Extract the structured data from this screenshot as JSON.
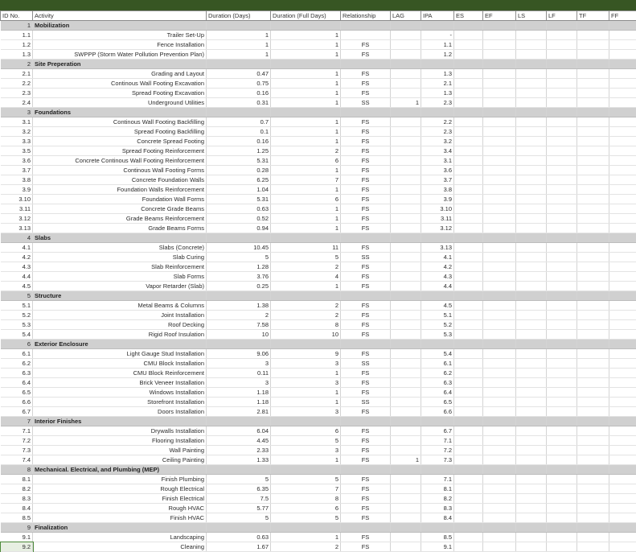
{
  "sheet": {
    "headers": [
      "ID No.",
      "Activity",
      "Duration (Days)",
      "Duration (Full Days)",
      "Relationship",
      "LAG",
      "IPA",
      "ES",
      "EF",
      "LS",
      "LF",
      "TF",
      "FF"
    ],
    "header_bar_color": "#375623",
    "section_fill_color": "#d0d0d0",
    "rows": [
      {
        "type": "section",
        "id": "1",
        "name": "Mobilization"
      },
      {
        "type": "task",
        "id": "1.1",
        "activity": "Trailer Set-Up",
        "dur": "1",
        "full": "1",
        "rel": "",
        "lag": "",
        "ipa": "-"
      },
      {
        "type": "task",
        "id": "1.2",
        "activity": "Fence Installation",
        "dur": "1",
        "full": "1",
        "rel": "FS",
        "lag": "",
        "ipa": "1.1"
      },
      {
        "type": "task",
        "id": "1.3",
        "activity": "SWPPP (Storm Water Pollution Prevention Plan)",
        "dur": "1",
        "full": "1",
        "rel": "FS",
        "lag": "",
        "ipa": "1.2"
      },
      {
        "type": "section",
        "id": "2",
        "name": "Site Preperation"
      },
      {
        "type": "task",
        "id": "2.1",
        "activity": "Grading and Layout",
        "dur": "0.47",
        "full": "1",
        "rel": "FS",
        "lag": "",
        "ipa": "1.3"
      },
      {
        "type": "task",
        "id": "2.2",
        "activity": "Continous Wall Footing Excavation",
        "dur": "0.75",
        "full": "1",
        "rel": "FS",
        "lag": "",
        "ipa": "2.1"
      },
      {
        "type": "task",
        "id": "2.3",
        "activity": "Spread Footing Excavation",
        "dur": "0.16",
        "full": "1",
        "rel": "FS",
        "lag": "",
        "ipa": "1.3"
      },
      {
        "type": "task",
        "id": "2.4",
        "activity": "Underground Utilities",
        "dur": "0.31",
        "full": "1",
        "rel": "SS",
        "lag": "1",
        "ipa": "2.3"
      },
      {
        "type": "section",
        "id": "3",
        "name": "Foundations"
      },
      {
        "type": "task",
        "id": "3.1",
        "activity": "Continous Wall Footing Backfilling",
        "dur": "0.7",
        "full": "1",
        "rel": "FS",
        "lag": "",
        "ipa": "2.2"
      },
      {
        "type": "task",
        "id": "3.2",
        "activity": "Spread Footing Backfilling",
        "dur": "0.1",
        "full": "1",
        "rel": "FS",
        "lag": "",
        "ipa": "2.3"
      },
      {
        "type": "task",
        "id": "3.3",
        "activity": "Concrete Spread Footing",
        "dur": "0.16",
        "full": "1",
        "rel": "FS",
        "lag": "",
        "ipa": "3.2"
      },
      {
        "type": "task",
        "id": "3.5",
        "activity": "Spread Footing Reinforcement",
        "dur": "1.25",
        "full": "2",
        "rel": "FS",
        "lag": "",
        "ipa": "3.4"
      },
      {
        "type": "task",
        "id": "3.6",
        "activity": "Concrete Continous Wall Footing Reinforcement",
        "dur": "5.31",
        "full": "6",
        "rel": "FS",
        "lag": "",
        "ipa": "3.1"
      },
      {
        "type": "task",
        "id": "3.7",
        "activity": "Continous Wall Footing Forms",
        "dur": "0.28",
        "full": "1",
        "rel": "FS",
        "lag": "",
        "ipa": "3.6"
      },
      {
        "type": "task",
        "id": "3.8",
        "activity": "Concrete Foundation Walls",
        "dur": "6.25",
        "full": "7",
        "rel": "FS",
        "lag": "",
        "ipa": "3.7"
      },
      {
        "type": "task",
        "id": "3.9",
        "activity": "Foundation Walls Reinforcement",
        "dur": "1.04",
        "full": "1",
        "rel": "FS",
        "lag": "",
        "ipa": "3.8"
      },
      {
        "type": "task",
        "id": "3.10",
        "activity": "Foundation Wall Forms",
        "dur": "5.31",
        "full": "6",
        "rel": "FS",
        "lag": "",
        "ipa": "3.9"
      },
      {
        "type": "task",
        "id": "3.11",
        "activity": "Concrete Grade Beams",
        "dur": "0.63",
        "full": "1",
        "rel": "FS",
        "lag": "",
        "ipa": "3.10"
      },
      {
        "type": "task",
        "id": "3.12",
        "activity": "Grade Beams Reinforcement",
        "dur": "0.52",
        "full": "1",
        "rel": "FS",
        "lag": "",
        "ipa": "3.11"
      },
      {
        "type": "task",
        "id": "3.13",
        "activity": "Grade Beams Forms",
        "dur": "0.94",
        "full": "1",
        "rel": "FS",
        "lag": "",
        "ipa": "3.12"
      },
      {
        "type": "section",
        "id": "4",
        "name": "Slabs"
      },
      {
        "type": "task",
        "id": "4.1",
        "activity": "Slabs (Concrete)",
        "dur": "10.45",
        "full": "11",
        "rel": "FS",
        "lag": "",
        "ipa": "3.13"
      },
      {
        "type": "task",
        "id": "4.2",
        "activity": "Slab Curing",
        "dur": "5",
        "full": "5",
        "rel": "SS",
        "lag": "",
        "ipa": "4.1"
      },
      {
        "type": "task",
        "id": "4.3",
        "activity": "Slab Reinforcement",
        "dur": "1.28",
        "full": "2",
        "rel": "FS",
        "lag": "",
        "ipa": "4.2"
      },
      {
        "type": "task",
        "id": "4.4",
        "activity": "Slab Forms",
        "dur": "3.76",
        "full": "4",
        "rel": "FS",
        "lag": "",
        "ipa": "4.3"
      },
      {
        "type": "task",
        "id": "4.5",
        "activity": "Vapor Retarder (Slab)",
        "dur": "0.25",
        "full": "1",
        "rel": "FS",
        "lag": "",
        "ipa": "4.4"
      },
      {
        "type": "section",
        "id": "5",
        "name": "Structure"
      },
      {
        "type": "task",
        "id": "5.1",
        "activity": "Metal Beams & Columns",
        "dur": "1.38",
        "full": "2",
        "rel": "FS",
        "lag": "",
        "ipa": "4.5"
      },
      {
        "type": "task",
        "id": "5.2",
        "activity": "Joint Installation",
        "dur": "2",
        "full": "2",
        "rel": "FS",
        "lag": "",
        "ipa": "5.1"
      },
      {
        "type": "task",
        "id": "5.3",
        "activity": "Roof Decking",
        "dur": "7.58",
        "full": "8",
        "rel": "FS",
        "lag": "",
        "ipa": "5.2"
      },
      {
        "type": "task",
        "id": "5.4",
        "activity": "Rigid Roof Insulation",
        "dur": "10",
        "full": "10",
        "rel": "FS",
        "lag": "",
        "ipa": "5.3"
      },
      {
        "type": "section",
        "id": "6",
        "name": "Exterior Enclosure"
      },
      {
        "type": "task",
        "id": "6.1",
        "activity": "Light Gauge Stud Installation",
        "dur": "9.06",
        "full": "9",
        "rel": "FS",
        "lag": "",
        "ipa": "5.4"
      },
      {
        "type": "task",
        "id": "6.2",
        "activity": "CMU Block Installation",
        "dur": "3",
        "full": "3",
        "rel": "SS",
        "lag": "",
        "ipa": "6.1"
      },
      {
        "type": "task",
        "id": "6.3",
        "activity": "CMU Block Reinforcement",
        "dur": "0.11",
        "full": "1",
        "rel": "FS",
        "lag": "",
        "ipa": "6.2"
      },
      {
        "type": "task",
        "id": "6.4",
        "activity": "Brick Veneer Installation",
        "dur": "3",
        "full": "3",
        "rel": "FS",
        "lag": "",
        "ipa": "6.3"
      },
      {
        "type": "task",
        "id": "6.5",
        "activity": "Windows Installation",
        "dur": "1.18",
        "full": "1",
        "rel": "FS",
        "lag": "",
        "ipa": "6.4"
      },
      {
        "type": "task",
        "id": "6.6",
        "activity": "Storefront Installation",
        "dur": "1.18",
        "full": "1",
        "rel": "SS",
        "lag": "",
        "ipa": "6.5"
      },
      {
        "type": "task",
        "id": "6.7",
        "activity": "Doors Installation",
        "dur": "2.81",
        "full": "3",
        "rel": "FS",
        "lag": "",
        "ipa": "6.6"
      },
      {
        "type": "section",
        "id": "7",
        "name": "Interior Finishes"
      },
      {
        "type": "task",
        "id": "7.1",
        "activity": "Drywalls Installation",
        "dur": "6.04",
        "full": "6",
        "rel": "FS",
        "lag": "",
        "ipa": "6.7"
      },
      {
        "type": "task",
        "id": "7.2",
        "activity": "Flooring Installation",
        "dur": "4.45",
        "full": "5",
        "rel": "FS",
        "lag": "",
        "ipa": "7.1"
      },
      {
        "type": "task",
        "id": "7.3",
        "activity": "Wall Painting",
        "dur": "2.33",
        "full": "3",
        "rel": "FS",
        "lag": "",
        "ipa": "7.2"
      },
      {
        "type": "task",
        "id": "7.4",
        "activity": "Ceiling Painting",
        "dur": "1.33",
        "full": "1",
        "rel": "FS",
        "lag": "1",
        "ipa": "7.3"
      },
      {
        "type": "section",
        "id": "8",
        "name": "Mechanical. Electrical, and Plumbing (MEP)"
      },
      {
        "type": "task",
        "id": "8.1",
        "activity": "Finish Plumbing",
        "dur": "5",
        "full": "5",
        "rel": "FS",
        "lag": "",
        "ipa": "7.1"
      },
      {
        "type": "task",
        "id": "8.2",
        "activity": "Rough Electrical",
        "dur": "6.35",
        "full": "7",
        "rel": "FS",
        "lag": "",
        "ipa": "8.1"
      },
      {
        "type": "task",
        "id": "8.3",
        "activity": "Finish Electrical",
        "dur": "7.5",
        "full": "8",
        "rel": "FS",
        "lag": "",
        "ipa": "8.2"
      },
      {
        "type": "task",
        "id": "8.4",
        "activity": "Rough HVAC",
        "dur": "5.77",
        "full": "6",
        "rel": "FS",
        "lag": "",
        "ipa": "8.3"
      },
      {
        "type": "task",
        "id": "8.5",
        "activity": "Finish HVAC",
        "dur": "5",
        "full": "5",
        "rel": "FS",
        "lag": "",
        "ipa": "8.4"
      },
      {
        "type": "section",
        "id": "9",
        "name": "Finalization"
      },
      {
        "type": "task",
        "id": "9.1",
        "activity": "Landscaping",
        "dur": "0.63",
        "full": "1",
        "rel": "FS",
        "lag": "",
        "ipa": "8.5"
      },
      {
        "type": "task",
        "id": "9.2",
        "activity": "Cleaning",
        "dur": "1.67",
        "full": "2",
        "rel": "FS",
        "lag": "",
        "ipa": "9.1",
        "selected": true
      }
    ]
  }
}
